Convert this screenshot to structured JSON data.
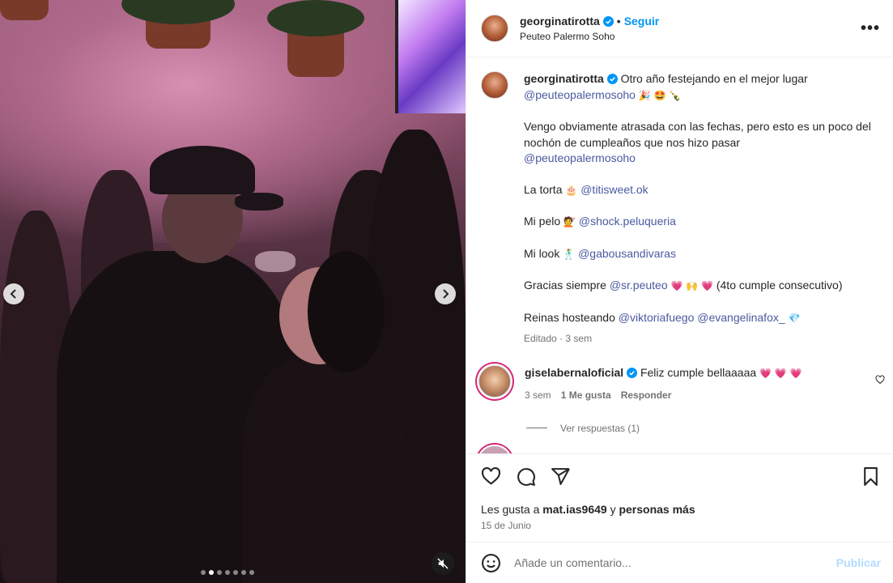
{
  "media": {
    "slide_count": 7,
    "active_slide_index": 1,
    "muted": true
  },
  "post": {
    "username": "georginatirotta",
    "follow_label": "Seguir",
    "separator": "•",
    "location": "Peuteo Palermo Soho"
  },
  "caption": {
    "username": "georginatirotta",
    "line1_text": "Otro año festejando en el mejor lugar",
    "line1_mention": "@peuteopalermosoho",
    "line1_emoji": "🎉 🤩 🍾",
    "para1_text": "Vengo obviamente atrasada con las fechas, pero esto es un poco del nochón de cumpleaños que nos hizo pasar",
    "para1_mention": "@peuteopalermosoho",
    "cake_label": "La torta",
    "cake_emoji": "🎂",
    "cake_mention": "@titisweet.ok",
    "hair_label": "Mi pelo",
    "hair_emoji": "💇",
    "hair_mention": "@shock.peluqueria",
    "look_label": "Mi look",
    "look_emoji": "🕺",
    "look_mention": "@gabousandivaras",
    "thanks_label": "Gracias siempre",
    "thanks_mention": "@sr.peuteo",
    "thanks_emoji": "💗 🙌 💗",
    "thanks_suffix": "(4to cumple consecutivo)",
    "queens_label": "Reinas hosteando",
    "queens_mention1": "@viktoriafuego",
    "queens_mention2": "@evangelinafox_",
    "queens_emoji": "💎",
    "edited": "Editado",
    "edited_sep": "·",
    "edited_time": "3 sem"
  },
  "comment": {
    "username": "giselabernaloficial",
    "text": "Feliz cumple bellaaaaa",
    "emoji": "💗 💗 💗",
    "time": "3 sem",
    "likes": "1 Me gusta",
    "reply": "Responder",
    "view_replies": "Ver respuestas (1)"
  },
  "actions": {
    "likes_prefix": "Les gusta a",
    "likes_user": "mat.ias9649",
    "likes_and": "y",
    "likes_others": "personas más",
    "date": "15 de Junio"
  },
  "add_comment": {
    "placeholder": "Añade un comentario...",
    "publish_label": "Publicar"
  },
  "colors": {
    "link": "#0095f6",
    "mention": "#4a5aa0",
    "muted_text": "#737373",
    "publish_disabled": "#b3dbff"
  }
}
